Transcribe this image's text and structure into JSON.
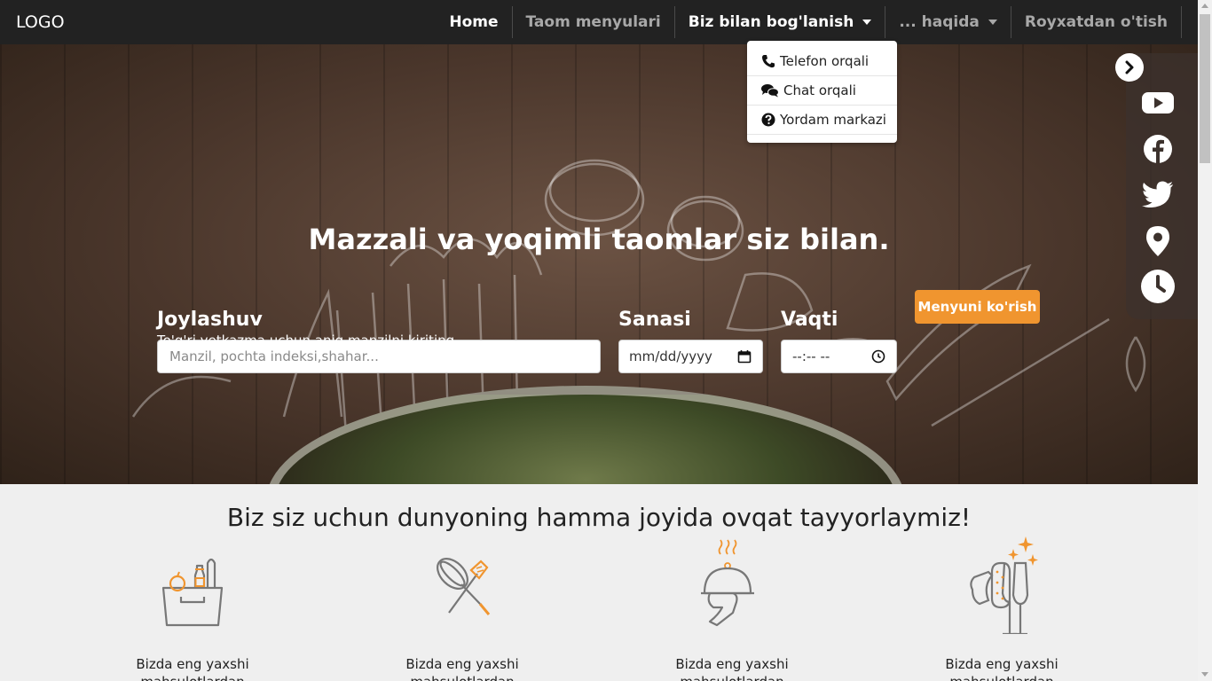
{
  "navbar": {
    "logo": "LOGO",
    "items": [
      {
        "label": "Home",
        "active": true,
        "dropdown": false
      },
      {
        "label": "Taom menyulari",
        "active": false,
        "dropdown": false
      },
      {
        "label": "Biz bilan bog'lanish",
        "active": false,
        "dropdown": true
      },
      {
        "label": "... haqida",
        "active": false,
        "dropdown": true
      },
      {
        "label": "Royxatdan o'tish",
        "active": false,
        "dropdown": false
      }
    ]
  },
  "dropdown": {
    "items": [
      {
        "icon": "phone-icon",
        "label": "Telefon orqali"
      },
      {
        "icon": "chat-icon",
        "label": "Chat orqali"
      },
      {
        "icon": "help-icon",
        "label": "Yordam markazi"
      }
    ]
  },
  "hero": {
    "title": "Mazzali va yoqimli taomlar siz bilan.",
    "location_label": "Joylashuv",
    "location_placeholder": "Manzil, pochta indeksi,shahar...",
    "location_hint": "To'g'ri yetkazma uchun aniq manzilni kiriting",
    "date_label": "Sanasi",
    "date_value": "mm/dd/yyyy",
    "time_label": "Vaqti",
    "time_value": "--:-- --",
    "menu_button": "Menyuni ko'rish"
  },
  "social": {
    "items": [
      "youtube-icon",
      "facebook-icon",
      "twitter-icon",
      "location-pin-icon",
      "clock-icon"
    ]
  },
  "section": {
    "title": "Biz siz uchun dunyoning hamma joyida ovqat tayyorlaymiz!",
    "features": [
      {
        "icon": "grocery-basket-icon",
        "text": "Bizda eng yaxshi mahsulotlardan"
      },
      {
        "icon": "whisk-spatula-icon",
        "text": "Bizda eng yaxshi mahsulotlardan"
      },
      {
        "icon": "serving-cloche-icon",
        "text": "Bizda eng yaxshi mahsulotlardan"
      },
      {
        "icon": "cleaning-glasses-icon",
        "text": "Bizda eng yaxshi mahsulotlardan"
      }
    ]
  },
  "colors": {
    "navbar_bg": "#222222",
    "accent": "#f0952f",
    "page_bg": "#efefef"
  }
}
